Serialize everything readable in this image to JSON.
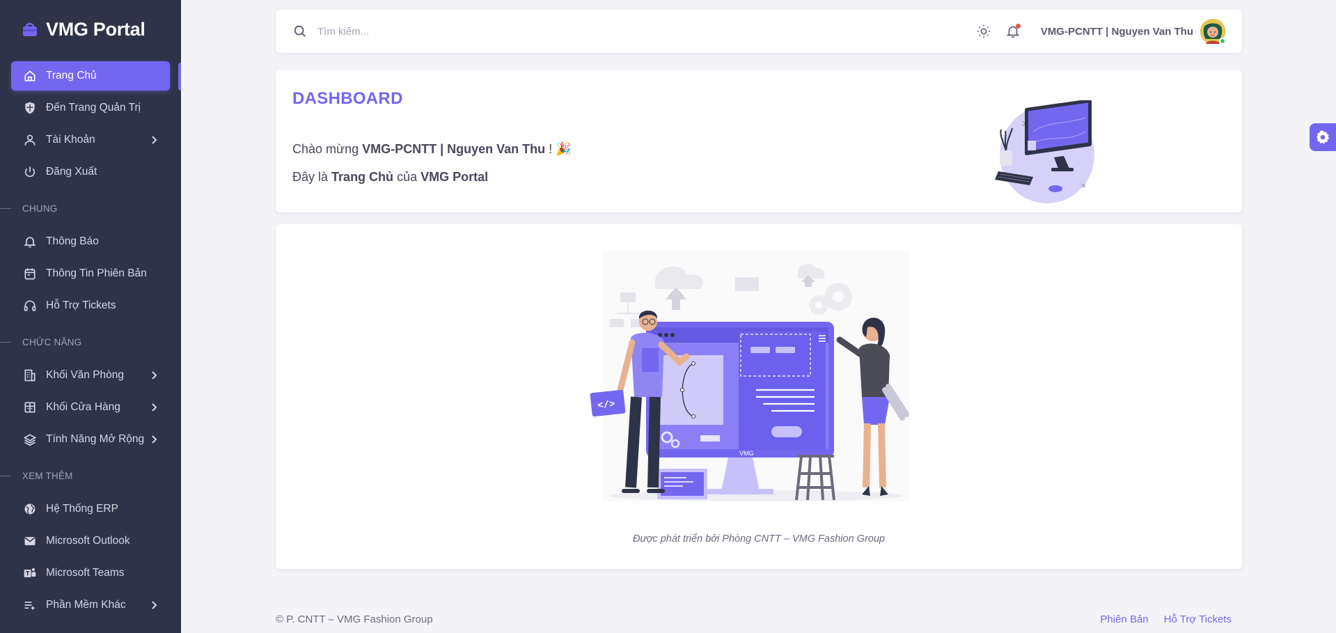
{
  "brand": {
    "name": "VMG Portal"
  },
  "sidebar": {
    "items": [
      {
        "label": "Trang Chủ",
        "icon": "home-icon"
      },
      {
        "label": "Đến Trang Quản Trị",
        "icon": "shield-icon"
      },
      {
        "label": "Tài Khoản",
        "icon": "user-icon"
      },
      {
        "label": "Đăng Xuất",
        "icon": "power-icon"
      }
    ],
    "sections": [
      {
        "header": "CHUNG",
        "items": [
          {
            "label": "Thông Báo",
            "icon": "bell-icon"
          },
          {
            "label": "Thông Tin Phiên Bản",
            "icon": "calendar-icon"
          },
          {
            "label": "Hỗ Trợ Tickets",
            "icon": "headset-icon"
          }
        ]
      },
      {
        "header": "CHỨC NĂNG",
        "items": [
          {
            "label": "Khối Văn Phòng",
            "icon": "building-icon"
          },
          {
            "label": "Khối Cửa Hàng",
            "icon": "store-icon"
          },
          {
            "label": "Tính Năng Mở Rộng",
            "icon": "layers-icon"
          }
        ]
      },
      {
        "header": "XEM THÊM",
        "items": [
          {
            "label": "Hệ Thống ERP",
            "icon": "globe-icon"
          },
          {
            "label": "Microsoft Outlook",
            "icon": "mail-icon"
          },
          {
            "label": "Microsoft Teams",
            "icon": "teams-icon"
          },
          {
            "label": "Phần Mềm Khác",
            "icon": "list-add-icon"
          }
        ]
      }
    ]
  },
  "navbar": {
    "search_placeholder": "Tìm kiếm...",
    "user_name": "VMG-PCNTT | Nguyen Van Thu"
  },
  "dashboard": {
    "title": "DASHBOARD",
    "greeting_prefix": "Chào mừng",
    "greeting_user": "VMG-PCNTT | Nguyen Van Thu",
    "greeting_suffix": "! 🎉",
    "line2_prefix": "Đây là",
    "line2_page": "Trang Chủ",
    "line2_mid": "của",
    "line2_app": "VMG Portal"
  },
  "illustration": {
    "screen_label": "VMG",
    "credit": "Được phát triển bởi Phòng CNTT – VMG Fashion Group"
  },
  "footer": {
    "copyright": "© P. CNTT – VMG Fashion Group",
    "version_link": "Phiên Bản",
    "support_link": "Hỗ Trợ Tickets"
  },
  "colors": {
    "primary": "#7367f0",
    "sidebar_bg": "#2f3349",
    "page_bg": "#f4f4f8",
    "online": "#28c76f"
  }
}
